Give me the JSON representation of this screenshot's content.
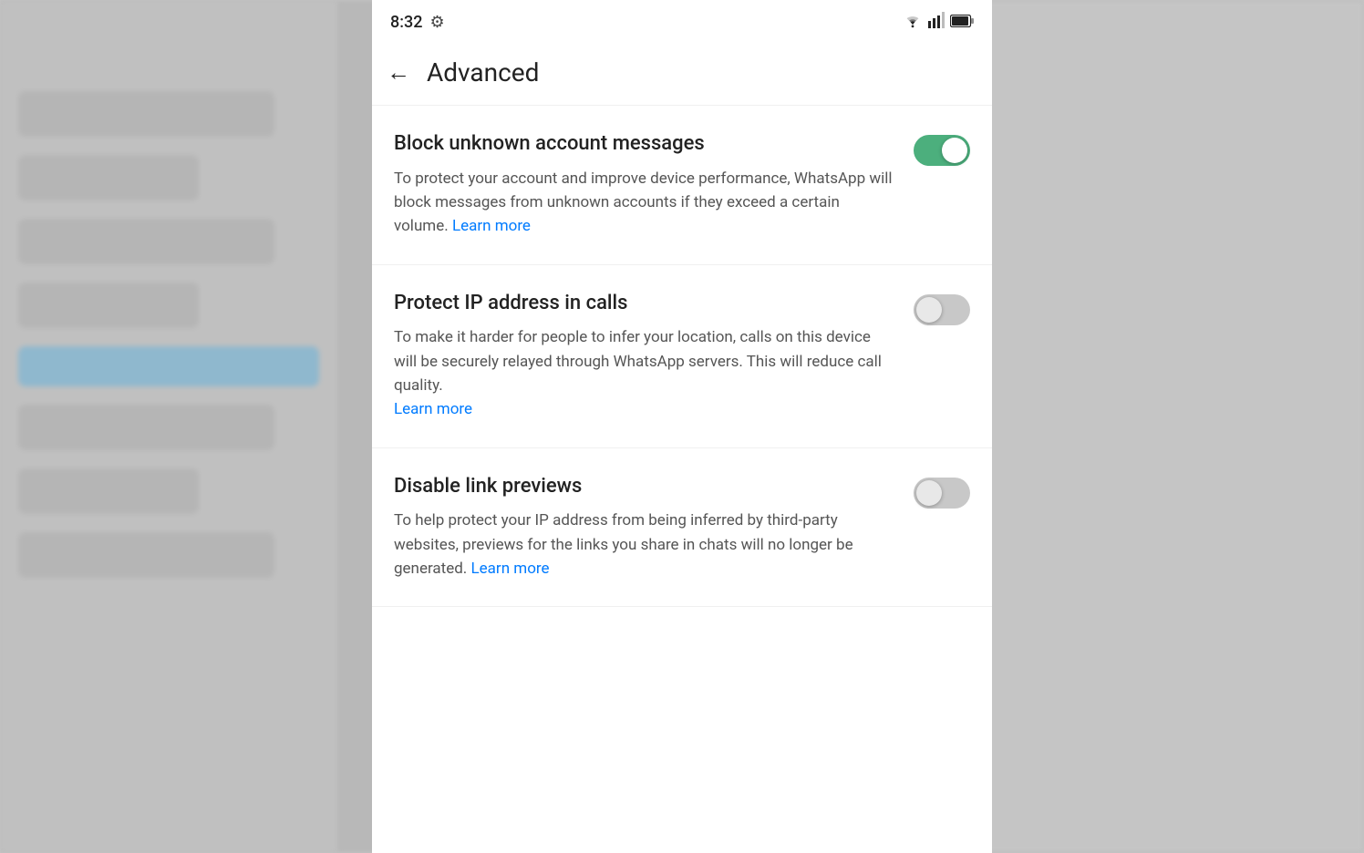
{
  "status_bar": {
    "time": "8:32",
    "gear_label": "⚙"
  },
  "header": {
    "back_arrow": "←",
    "title": "Advanced"
  },
  "settings": [
    {
      "id": "block-unknown",
      "title": "Block unknown account messages",
      "description": "To protect your account and improve device performance, WhatsApp will block messages from unknown accounts if they exceed a certain volume.",
      "learn_more_text": "Learn more",
      "toggle_on": true
    },
    {
      "id": "protect-ip",
      "title": "Protect IP address in calls",
      "description": "To make it harder for people to infer your location, calls on this device will be securely relayed through WhatsApp servers. This will reduce call quality.",
      "learn_more_text": "Learn more",
      "toggle_on": false
    },
    {
      "id": "disable-link-previews",
      "title": "Disable link previews",
      "description": "To help protect your IP address from being inferred by third-party websites, previews for the links you share in chats will no longer be generated.",
      "learn_more_text": "Learn more",
      "toggle_on": false
    }
  ],
  "colors": {
    "toggle_on": "#4CAF7D",
    "toggle_off": "#c8c8c8",
    "link": "#1a73e8"
  }
}
